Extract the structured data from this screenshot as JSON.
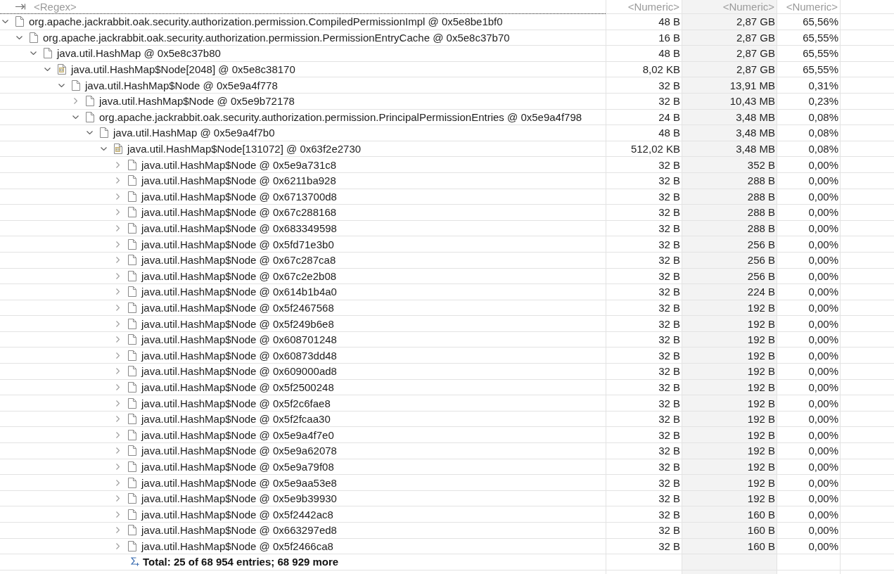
{
  "filter_row": [
    {
      "placeholder": "<Regex>"
    },
    {
      "placeholder": "<Numeric>"
    },
    {
      "placeholder": "<Numeric>"
    },
    {
      "placeholder": "<Numeric>"
    }
  ],
  "tree": [
    {
      "label": "org.apache.jackrabbit.oak.security.authorization.permission.CompiledPermissionImpl @ 0x5e8be1bf0",
      "kind": "object",
      "shallow": "48 B",
      "retained": "2,87 GB",
      "percentage": "65,56%",
      "expanded": true,
      "children": [
        {
          "label": "org.apache.jackrabbit.oak.security.authorization.permission.PermissionEntryCache @ 0x5e8c37b70",
          "kind": "object",
          "shallow": "16 B",
          "retained": "2,87 GB",
          "percentage": "65,55%",
          "expanded": true,
          "children": [
            {
              "label": "java.util.HashMap @ 0x5e8c37b80",
              "kind": "object",
              "shallow": "48 B",
              "retained": "2,87 GB",
              "percentage": "65,55%",
              "expanded": true,
              "children": [
                {
                  "label": "java.util.HashMap$Node[2048] @ 0x5e8c38170",
                  "kind": "array",
                  "shallow": "8,02 KB",
                  "retained": "2,87 GB",
                  "percentage": "65,55%",
                  "expanded": true,
                  "children": [
                    {
                      "label": "java.util.HashMap$Node @ 0x5e9a4f778",
                      "kind": "object",
                      "shallow": "32 B",
                      "retained": "13,91 MB",
                      "percentage": "0,31%",
                      "expanded": true,
                      "children": [
                        {
                          "label": "java.util.HashMap$Node @ 0x5e9b72178",
                          "kind": "object",
                          "shallow": "32 B",
                          "retained": "10,43 MB",
                          "percentage": "0,23%",
                          "expanded": false
                        },
                        {
                          "label": "org.apache.jackrabbit.oak.security.authorization.permission.PrincipalPermissionEntries @ 0x5e9a4f798",
                          "kind": "object",
                          "shallow": "24 B",
                          "retained": "3,48 MB",
                          "percentage": "0,08%",
                          "expanded": true,
                          "children": [
                            {
                              "label": "java.util.HashMap @ 0x5e9a4f7b0",
                              "kind": "object",
                              "shallow": "48 B",
                              "retained": "3,48 MB",
                              "percentage": "0,08%",
                              "expanded": true,
                              "children": [
                                {
                                  "label": "java.util.HashMap$Node[131072] @ 0x63f2e2730",
                                  "kind": "array",
                                  "shallow": "512,02 KB",
                                  "retained": "3,48 MB",
                                  "percentage": "0,08%",
                                  "expanded": true,
                                  "total": "Total: 25 of 68 954 entries; 68 929 more",
                                  "children": [
                                    {
                                      "label": "java.util.HashMap$Node @ 0x5e9a731c8",
                                      "kind": "object",
                                      "shallow": "32 B",
                                      "retained": "352 B",
                                      "percentage": "0,00%",
                                      "expanded": false
                                    },
                                    {
                                      "label": "java.util.HashMap$Node @ 0x6211ba928",
                                      "kind": "object",
                                      "shallow": "32 B",
                                      "retained": "288 B",
                                      "percentage": "0,00%",
                                      "expanded": false
                                    },
                                    {
                                      "label": "java.util.HashMap$Node @ 0x6713700d8",
                                      "kind": "object",
                                      "shallow": "32 B",
                                      "retained": "288 B",
                                      "percentage": "0,00%",
                                      "expanded": false
                                    },
                                    {
                                      "label": "java.util.HashMap$Node @ 0x67c288168",
                                      "kind": "object",
                                      "shallow": "32 B",
                                      "retained": "288 B",
                                      "percentage": "0,00%",
                                      "expanded": false
                                    },
                                    {
                                      "label": "java.util.HashMap$Node @ 0x683349598",
                                      "kind": "object",
                                      "shallow": "32 B",
                                      "retained": "288 B",
                                      "percentage": "0,00%",
                                      "expanded": false
                                    },
                                    {
                                      "label": "java.util.HashMap$Node @ 0x5fd71e3b0",
                                      "kind": "object",
                                      "shallow": "32 B",
                                      "retained": "256 B",
                                      "percentage": "0,00%",
                                      "expanded": false
                                    },
                                    {
                                      "label": "java.util.HashMap$Node @ 0x67c287ca8",
                                      "kind": "object",
                                      "shallow": "32 B",
                                      "retained": "256 B",
                                      "percentage": "0,00%",
                                      "expanded": false
                                    },
                                    {
                                      "label": "java.util.HashMap$Node @ 0x67c2e2b08",
                                      "kind": "object",
                                      "shallow": "32 B",
                                      "retained": "256 B",
                                      "percentage": "0,00%",
                                      "expanded": false
                                    },
                                    {
                                      "label": "java.util.HashMap$Node @ 0x614b1b4a0",
                                      "kind": "object",
                                      "shallow": "32 B",
                                      "retained": "224 B",
                                      "percentage": "0,00%",
                                      "expanded": false
                                    },
                                    {
                                      "label": "java.util.HashMap$Node @ 0x5f2467568",
                                      "kind": "object",
                                      "shallow": "32 B",
                                      "retained": "192 B",
                                      "percentage": "0,00%",
                                      "expanded": false
                                    },
                                    {
                                      "label": "java.util.HashMap$Node @ 0x5f249b6e8",
                                      "kind": "object",
                                      "shallow": "32 B",
                                      "retained": "192 B",
                                      "percentage": "0,00%",
                                      "expanded": false
                                    },
                                    {
                                      "label": "java.util.HashMap$Node @ 0x608701248",
                                      "kind": "object",
                                      "shallow": "32 B",
                                      "retained": "192 B",
                                      "percentage": "0,00%",
                                      "expanded": false
                                    },
                                    {
                                      "label": "java.util.HashMap$Node @ 0x60873dd48",
                                      "kind": "object",
                                      "shallow": "32 B",
                                      "retained": "192 B",
                                      "percentage": "0,00%",
                                      "expanded": false
                                    },
                                    {
                                      "label": "java.util.HashMap$Node @ 0x609000ad8",
                                      "kind": "object",
                                      "shallow": "32 B",
                                      "retained": "192 B",
                                      "percentage": "0,00%",
                                      "expanded": false
                                    },
                                    {
                                      "label": "java.util.HashMap$Node @ 0x5f2500248",
                                      "kind": "object",
                                      "shallow": "32 B",
                                      "retained": "192 B",
                                      "percentage": "0,00%",
                                      "expanded": false
                                    },
                                    {
                                      "label": "java.util.HashMap$Node @ 0x5f2c6fae8",
                                      "kind": "object",
                                      "shallow": "32 B",
                                      "retained": "192 B",
                                      "percentage": "0,00%",
                                      "expanded": false
                                    },
                                    {
                                      "label": "java.util.HashMap$Node @ 0x5f2fcaa30",
                                      "kind": "object",
                                      "shallow": "32 B",
                                      "retained": "192 B",
                                      "percentage": "0,00%",
                                      "expanded": false
                                    },
                                    {
                                      "label": "java.util.HashMap$Node @ 0x5e9a4f7e0",
                                      "kind": "object",
                                      "shallow": "32 B",
                                      "retained": "192 B",
                                      "percentage": "0,00%",
                                      "expanded": false
                                    },
                                    {
                                      "label": "java.util.HashMap$Node @ 0x5e9a62078",
                                      "kind": "object",
                                      "shallow": "32 B",
                                      "retained": "192 B",
                                      "percentage": "0,00%",
                                      "expanded": false
                                    },
                                    {
                                      "label": "java.util.HashMap$Node @ 0x5e9a79f08",
                                      "kind": "object",
                                      "shallow": "32 B",
                                      "retained": "192 B",
                                      "percentage": "0,00%",
                                      "expanded": false
                                    },
                                    {
                                      "label": "java.util.HashMap$Node @ 0x5e9aa53e8",
                                      "kind": "object",
                                      "shallow": "32 B",
                                      "retained": "192 B",
                                      "percentage": "0,00%",
                                      "expanded": false
                                    },
                                    {
                                      "label": "java.util.HashMap$Node @ 0x5e9b39930",
                                      "kind": "object",
                                      "shallow": "32 B",
                                      "retained": "192 B",
                                      "percentage": "0,00%",
                                      "expanded": false
                                    },
                                    {
                                      "label": "java.util.HashMap$Node @ 0x5f2442ac8",
                                      "kind": "object",
                                      "shallow": "32 B",
                                      "retained": "160 B",
                                      "percentage": "0,00%",
                                      "expanded": false
                                    },
                                    {
                                      "label": "java.util.HashMap$Node @ 0x663297ed8",
                                      "kind": "object",
                                      "shallow": "32 B",
                                      "retained": "160 B",
                                      "percentage": "0,00%",
                                      "expanded": false
                                    },
                                    {
                                      "label": "java.util.HashMap$Node @ 0x5f2466ca8",
                                      "kind": "object",
                                      "shallow": "32 B",
                                      "retained": "160 B",
                                      "percentage": "0,00%",
                                      "expanded": false
                                    }
                                  ]
                                }
                              ]
                            }
                          ]
                        }
                      ]
                    }
                  ]
                }
              ]
            }
          ]
        }
      ]
    }
  ]
}
